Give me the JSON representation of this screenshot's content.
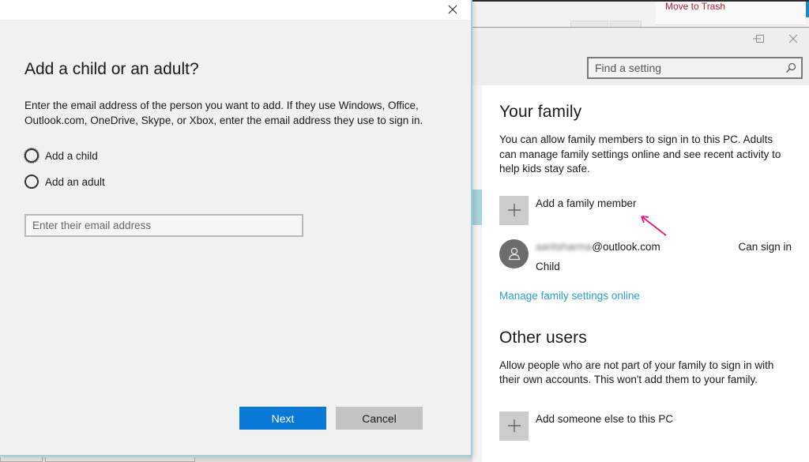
{
  "background_page": {
    "link_text": "Move to Trash",
    "link_color": "#b0213b"
  },
  "settings": {
    "window_controls": {
      "minimize_icon": "minimize-icon",
      "maximize_icon": "maximize-icon",
      "close_icon": "close-icon"
    },
    "search": {
      "placeholder": "Find a setting",
      "value": "",
      "icon": "search-icon"
    },
    "family": {
      "title": "Your family",
      "description": "You can allow family members to sign in to this PC. Adults can manage family settings online and see recent activity to help kids stay safe.",
      "add_label": "Add a family member",
      "add_icon": "plus-icon",
      "members": [
        {
          "email_user_blurred": "aaritsharma",
          "email_domain": "@outlook.com",
          "role": "Child",
          "status": "Can sign in",
          "avatar_icon": "person-icon"
        }
      ],
      "manage_link": "Manage family settings online",
      "link_color": "#2aa3c7"
    },
    "other_users": {
      "title": "Other users",
      "description": "Allow people who are not part of your family to sign in with their own accounts. This won't add them to your family.",
      "add_label": "Add someone else to this PC",
      "add_icon": "plus-icon"
    },
    "annotation_arrow_color": "#e8197a"
  },
  "dialog": {
    "title": "Add a child or an adult?",
    "description": "Enter the email address of the person you want to add. If they use Windows, Office, Outlook.com, OneDrive, Skype, or Xbox, enter the email address they use to sign in.",
    "options": [
      {
        "label": "Add a child",
        "selected": false,
        "focused": true
      },
      {
        "label": "Add an adult",
        "selected": false,
        "focused": false
      }
    ],
    "email_input": {
      "placeholder": "Enter their email address",
      "value": ""
    },
    "buttons": {
      "next": "Next",
      "cancel": "Cancel"
    },
    "accent_color": "#0a78d7"
  }
}
